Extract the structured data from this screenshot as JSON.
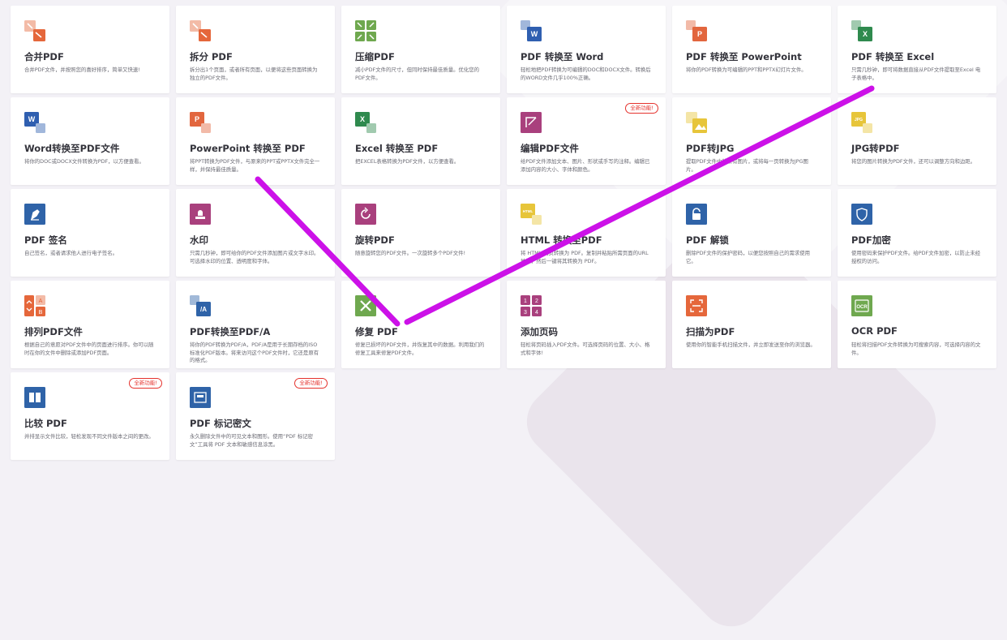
{
  "badge_label": "全新功能!",
  "tools": [
    {
      "title": "合并PDF",
      "desc": "合并PDF文件，并按照您的喜好排序，简单又快速!",
      "icon": "merge-icon",
      "color": "#e5673b",
      "badge": false
    },
    {
      "title": "拆分 PDF",
      "desc": "拆分出1个页面，或者所有页面，以便将这些页面转换为独立的PDF文件。",
      "icon": "split-icon",
      "color": "#e5673b",
      "badge": false
    },
    {
      "title": "压缩PDF",
      "desc": "减小PDF文件的尺寸，但同时保持最佳质量。优化您的PDF文件。",
      "icon": "compress-icon",
      "color": "#6fa84f",
      "badge": false
    },
    {
      "title": "PDF 转换至 Word",
      "desc": "轻松地把PDF转换为可编辑的DOC和DOCX文件。转换后的WORD文件几乎100%正确。",
      "icon": "word-icon",
      "color": "#2f5fb0",
      "badge": false
    },
    {
      "title": "PDF 转换至 PowerPoint",
      "desc": "将你的PDF转换为可编辑的PPT和PPTX幻灯片文件。",
      "icon": "powerpoint-icon",
      "color": "#e2663e",
      "badge": false
    },
    {
      "title": "PDF 转换至 Excel",
      "desc": "只需几秒钟，即可将数据直接从PDF文件提取至Excel 电子表格中。",
      "icon": "excel-icon",
      "color": "#2f8a4e",
      "badge": false
    },
    {
      "title": "Word转换至PDF文件",
      "desc": "将你的DOC或DOCX文件转换为PDF，以方便查看。",
      "icon": "word-to-pdf-icon",
      "color": "#2f5fb0",
      "badge": false
    },
    {
      "title": "PowerPoint 转换至 PDF",
      "desc": "将PPT转换为PDF文件，与原来的PPT或PPTX文件完全一样，并保持最佳质量。",
      "icon": "powerpoint-to-pdf-icon",
      "color": "#e2663e",
      "badge": false
    },
    {
      "title": "Excel 转换至 PDF",
      "desc": "把EXCEL表格转换为PDF文件，以方便查看。",
      "icon": "excel-to-pdf-icon",
      "color": "#2f8a4e",
      "badge": false
    },
    {
      "title": "编辑PDF文件",
      "desc": "给PDF文件添加文本、图片、形状或手写的注释。编辑已添加内容的大小、字体和颜色。",
      "icon": "edit-icon",
      "color": "#a9407d",
      "badge": true
    },
    {
      "title": "PDF转JPG",
      "desc": "提取PDF文件中的所有图片，或将每一页转换为JPG图片。",
      "icon": "pdf-to-jpg-icon",
      "color": "#e7c53a",
      "badge": false
    },
    {
      "title": "JPG转PDF",
      "desc": "将您的图片转换为PDF文件，还可以调整方向和边距。",
      "icon": "jpg-to-pdf-icon",
      "color": "#e7c53a",
      "badge": false
    },
    {
      "title": "PDF 签名",
      "desc": "自己签名，或者请求他人进行电子签名。",
      "icon": "sign-icon",
      "color": "#2f63a8",
      "badge": false
    },
    {
      "title": "水印",
      "desc": "只需几秒钟，即可给你的PDF文件添加图片或文字水印。可选择水印的位置、透明度和字体。",
      "icon": "watermark-icon",
      "color": "#a9407d",
      "badge": false
    },
    {
      "title": "旋转PDF",
      "desc": "随意旋转您的PDF文件。一次旋转多个PDF文件!",
      "icon": "rotate-icon",
      "color": "#a9407d",
      "badge": false
    },
    {
      "title": "HTML 转换至PDF",
      "desc": "将 HTML 网页转换为 PDF。复制并粘贴所需页面的URL地址，然后一键将其转换为 PDF。",
      "icon": "html-icon",
      "color": "#e7c53a",
      "badge": false
    },
    {
      "title": "PDF 解锁",
      "desc": "删除PDF文件的保护密码，以便您按照自己的需求使用它。",
      "icon": "unlock-icon",
      "color": "#2f63a8",
      "badge": false
    },
    {
      "title": "PDF加密",
      "desc": "使用密码来保护PDF文件。给PDF文件加密，以防止未经授权的访问。",
      "icon": "protect-icon",
      "color": "#2f63a8",
      "badge": false
    },
    {
      "title": "排列PDF文件",
      "desc": "根据自己的意愿对PDF文件中的页面进行排序。你可以随时在你的文件中删除或添加PDF页面。",
      "icon": "organize-icon",
      "color": "#e5673b",
      "badge": false
    },
    {
      "title": "PDF转换至PDF/A",
      "desc": "将你的PDF转换为PDF/A，PDF/A是用于长期存档的ISO标准化PDF版本。将来访问这个PDF文件时，它还是原有的格式。",
      "icon": "pdfa-icon",
      "color": "#2f63a8",
      "badge": false
    },
    {
      "title": "修复 PDF",
      "desc": "修复已损坏的PDF文件，并恢复其中的数据。利用我们的修复工具来修复PDF文件。",
      "icon": "repair-icon",
      "color": "#6fa84f",
      "badge": false
    },
    {
      "title": "添加页码",
      "desc": "轻松将页码插入PDF文件。可选择页码的位置、大小、格式和字体!",
      "icon": "page-numbers-icon",
      "color": "#a9407d",
      "badge": false
    },
    {
      "title": "扫描为PDF",
      "desc": "使用你的智能手机扫描文件，并立即发送至你的浏览器。",
      "icon": "scan-icon",
      "color": "#e5673b",
      "badge": false
    },
    {
      "title": "OCR PDF",
      "desc": "轻松将扫描PDF文件转换为可搜索内容，可选择内容的文件。",
      "icon": "ocr-icon",
      "color": "#6fa84f",
      "badge": false
    },
    {
      "title": "比较 PDF",
      "desc": "并排显示文件比较，轻松发现不同文件版本之间的更改。",
      "icon": "compare-icon",
      "color": "#2f63a8",
      "badge": true
    },
    {
      "title": "PDF 标记密文",
      "desc": "永久删除文件中的可见文本和图形。使用“PDF 标记密文”工具将 PDF 文本和敏感信息涂黑。",
      "icon": "redact-icon",
      "color": "#2f63a8",
      "badge": true
    }
  ]
}
